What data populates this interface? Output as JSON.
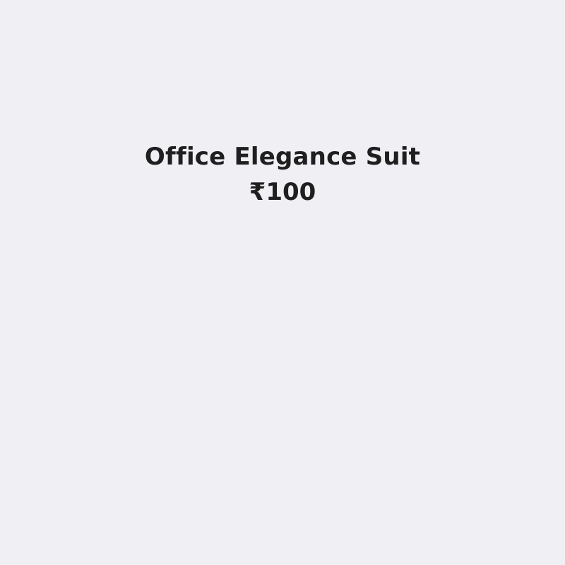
{
  "product": {
    "name": "Office Elegance Suit",
    "price": "₹100"
  },
  "colors": {
    "background": "#f0eff4",
    "text": "#1f1f1f"
  }
}
